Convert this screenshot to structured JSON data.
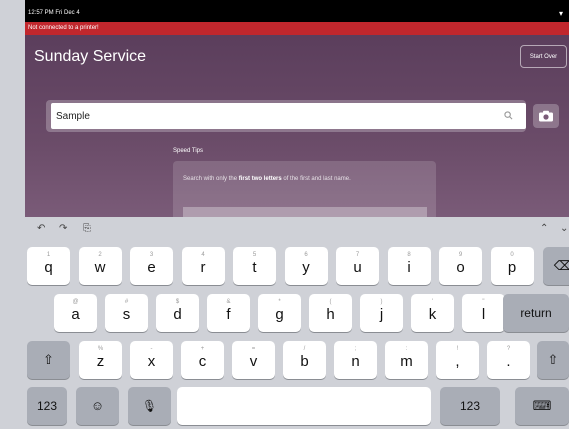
{
  "status_bar": {
    "time": "12:57 PM  Fri Dec 4",
    "battery": "▾"
  },
  "alert": {
    "text": "Not connected to a printer!"
  },
  "header": {
    "title": "Sunday Service",
    "start_over": "Start Over"
  },
  "search": {
    "value": "Sample"
  },
  "tips": {
    "title": "Speed Tips",
    "text_pre": "Search with only the ",
    "text_bold": "first two letters",
    "text_post": " of the first and last name."
  },
  "keyboard": {
    "toolbar": {
      "undo": "↶",
      "redo": "↷",
      "paste": "⎘",
      "up": "⌃",
      "down": "⌄"
    },
    "row1": [
      {
        "s": "1",
        "m": "q"
      },
      {
        "s": "2",
        "m": "w"
      },
      {
        "s": "3",
        "m": "e"
      },
      {
        "s": "4",
        "m": "r"
      },
      {
        "s": "5",
        "m": "t"
      },
      {
        "s": "6",
        "m": "y"
      },
      {
        "s": "7",
        "m": "u"
      },
      {
        "s": "8",
        "m": "i"
      },
      {
        "s": "9",
        "m": "o"
      },
      {
        "s": "0",
        "m": "p"
      }
    ],
    "row2": [
      {
        "s": "@",
        "m": "a"
      },
      {
        "s": "#",
        "m": "s"
      },
      {
        "s": "$",
        "m": "d"
      },
      {
        "s": "&",
        "m": "f"
      },
      {
        "s": "*",
        "m": "g"
      },
      {
        "s": "(",
        "m": "h"
      },
      {
        "s": ")",
        "m": "j"
      },
      {
        "s": "'",
        "m": "k"
      },
      {
        "s": "\"",
        "m": "l"
      }
    ],
    "row3": [
      {
        "s": "%",
        "m": "z"
      },
      {
        "s": "-",
        "m": "x"
      },
      {
        "s": "+",
        "m": "c"
      },
      {
        "s": "=",
        "m": "v"
      },
      {
        "s": "/",
        "m": "b"
      },
      {
        "s": ";",
        "m": "n"
      },
      {
        "s": ":",
        "m": "m"
      },
      {
        "s": "!",
        "m": ","
      },
      {
        "s": "?",
        "m": "."
      }
    ],
    "delete": "⌫",
    "return": "return",
    "shift": "⇧",
    "numbers": "123",
    "emoji": "☺",
    "mic": "🎙",
    "hide": "⌨"
  }
}
